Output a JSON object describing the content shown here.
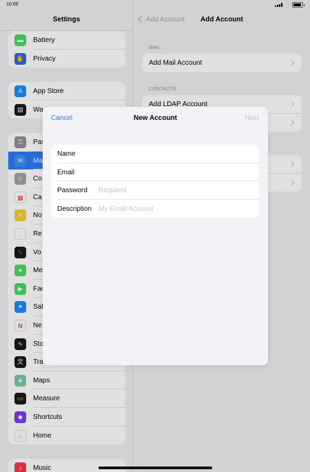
{
  "status": {
    "time": "10:00"
  },
  "sidebar": {
    "title": "Settings",
    "groups": [
      {
        "items": [
          {
            "label": "Battery",
            "icon": "battery-icon",
            "color": "#4cd964",
            "glyph": "▬"
          },
          {
            "label": "Privacy",
            "icon": "hand-icon",
            "color": "#2f6ad9",
            "glyph": "✋"
          }
        ]
      },
      {
        "items": [
          {
            "label": "App Store",
            "icon": "app-store-icon",
            "color": "#1c8ef9",
            "glyph": "A"
          },
          {
            "label": "Wa",
            "icon": "wallet-icon",
            "color": "#1a1a1a",
            "glyph": "▤"
          }
        ]
      },
      {
        "items": [
          {
            "label": "Pas",
            "icon": "key-icon",
            "color": "#8e8e93",
            "glyph": "⚿"
          },
          {
            "label": "Ma",
            "icon": "mail-icon",
            "color": "#3e8ef7",
            "glyph": "✉"
          },
          {
            "label": "Co",
            "icon": "contacts-icon",
            "color": "#a2a2a6",
            "glyph": "☺"
          },
          {
            "label": "Ca",
            "icon": "calendar-icon",
            "color": "#ffffff",
            "glyph": "▦"
          },
          {
            "label": "No",
            "icon": "notes-icon",
            "color": "#f5d03c",
            "glyph": "≡"
          },
          {
            "label": "Re",
            "icon": "reminders-icon",
            "color": "#ffffff",
            "glyph": "⋮"
          },
          {
            "label": "Vo",
            "icon": "voice-memos-icon",
            "color": "#1a1a1a",
            "glyph": "∿"
          },
          {
            "label": "Me",
            "icon": "messages-icon",
            "color": "#4cd964",
            "glyph": "●"
          },
          {
            "label": "Fac",
            "icon": "facetime-icon",
            "color": "#4cd964",
            "glyph": "▶"
          },
          {
            "label": "Saf",
            "icon": "safari-icon",
            "color": "#1c8ef9",
            "glyph": "✦"
          },
          {
            "label": "Ne",
            "icon": "news-icon",
            "color": "#ffffff",
            "glyph": "N"
          },
          {
            "label": "Sto",
            "icon": "stocks-icon",
            "color": "#1a1a1a",
            "glyph": "∿"
          },
          {
            "label": "Tra",
            "icon": "translate-icon",
            "color": "#1a1a1a",
            "glyph": "文"
          },
          {
            "label": "Maps",
            "icon": "maps-icon",
            "color": "#7ec8a8",
            "glyph": "◈"
          },
          {
            "label": "Measure",
            "icon": "measure-icon",
            "color": "#1a1a1a",
            "glyph": "▭"
          },
          {
            "label": "Shortcuts",
            "icon": "shortcuts-icon",
            "color": "#7a3df0",
            "glyph": "◆"
          },
          {
            "label": "Home",
            "icon": "home-icon",
            "color": "#ffffff",
            "glyph": "⌂"
          }
        ]
      },
      {
        "items": [
          {
            "label": "Music",
            "icon": "music-icon",
            "color": "#f23c50",
            "glyph": "♪"
          }
        ]
      }
    ]
  },
  "detail": {
    "back_label": "Add Account",
    "title": "Add Account",
    "sections": [
      {
        "header": "MAIL",
        "rows": [
          "Add Mail Account"
        ]
      },
      {
        "header": "CONTACTS",
        "rows": [
          "Add LDAP Account",
          ""
        ]
      },
      {
        "header": "",
        "rows": [
          "",
          ""
        ]
      }
    ]
  },
  "modal": {
    "cancel": "Cancel",
    "title": "New Account",
    "next": "Next",
    "fields": [
      {
        "label": "Name",
        "value": "",
        "placeholder": ""
      },
      {
        "label": "Email",
        "value": "",
        "placeholder": ""
      },
      {
        "label": "Password",
        "value": "",
        "placeholder": "Required"
      },
      {
        "label": "Description",
        "value": "",
        "placeholder": "My Email Account"
      }
    ]
  },
  "colors": {
    "accent": "#3478f6",
    "selected_row": "#2f7bf6",
    "disabled": "#c2c2c7"
  }
}
